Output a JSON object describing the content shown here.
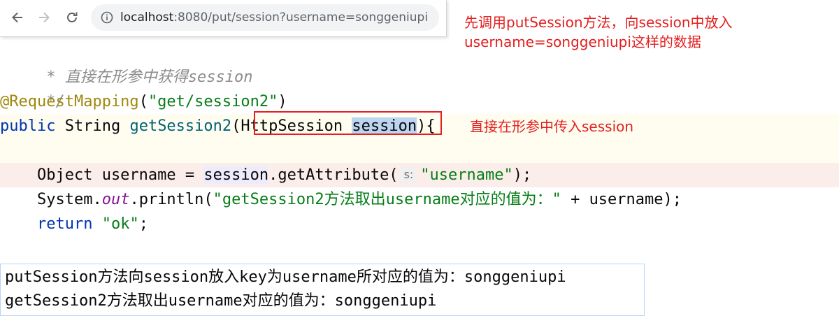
{
  "browser": {
    "url_host": "localhost",
    "url_path": ":8080/put/session?username=songgeniupi"
  },
  "annotations": {
    "top_right_line1": "先调用putSession方法，向session中放入",
    "top_right_line2": "username=songgeniupi这样的数据",
    "inline": "直接在形参中传入session"
  },
  "code": {
    "comment_line1": " * 直接在形参中获得session",
    "comment_line2": " */",
    "anno_name": "@RequestMapping",
    "anno_open": "(",
    "anno_value": "\"get/session2\"",
    "anno_close": ")",
    "kw_public": "public",
    "type_string": " String ",
    "method_name": "getSession2",
    "sig_open": "(",
    "param_type": "HttpSession ",
    "param_name": "session",
    "sig_close": "){",
    "l5_indent": "    Object username = ",
    "l5_session": "session",
    "l5_call": ".getAttribute(",
    "l5_hint": "s:",
    "l5_arg": "\"username\"",
    "l5_end": ");",
    "l6_indent": "    System.",
    "l6_out": "out",
    "l6_call": ".println(",
    "l6_str": "\"getSession2方法取出username对应的值为：\"",
    "l6_end": " + username);",
    "l7_indent": "    ",
    "l7_kw": "return",
    "l7_sp": " ",
    "l7_str": "\"ok\"",
    "l7_end": ";",
    "close_brace": "}"
  },
  "console": {
    "line1": "putSession方法向session放入key为username所对应的值为：songgeniupi",
    "line2": "getSession2方法取出username对应的值为：songgeniupi"
  },
  "colors": {
    "annotation_red": "#e31f1f",
    "keyword_blue": "#0033b3",
    "string_green": "#067d17",
    "annotation_gold": "#9e880d"
  }
}
